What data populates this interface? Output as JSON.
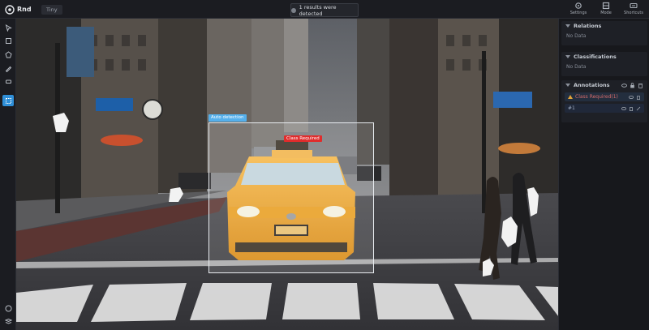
{
  "app": {
    "logo_text": "Rnd"
  },
  "tabs": {
    "file_tab": "Tiny"
  },
  "detection": {
    "status": "1 results were detected"
  },
  "top_actions": [
    {
      "label": "Settings"
    },
    {
      "label": "Mode"
    },
    {
      "label": "Shortcuts"
    }
  ],
  "tools": [
    {
      "icon": "select-tool-icon"
    },
    {
      "icon": "rectangle-tool-icon"
    },
    {
      "icon": "polygon-tool-icon"
    },
    {
      "icon": "brush-tool-icon"
    },
    {
      "icon": "eraser-tool-icon"
    },
    {
      "icon": "magic-wand-tool-icon"
    },
    {
      "icon": "auto-detect-tool-icon"
    }
  ],
  "canvas": {
    "bbox_label": "Auto detection",
    "class_label": "Class Required"
  },
  "panel": {
    "section1": {
      "title": "Relations",
      "empty_text": "No Data"
    },
    "section2": {
      "title": "Classifications",
      "empty_text": "No Data"
    },
    "section3": {
      "title": "Annotations",
      "rows": [
        {
          "label": "Class Required(1)"
        },
        {
          "label": "#1"
        }
      ]
    }
  },
  "colors": {
    "accent": "#2f8fd8",
    "bbox_tag": "#55b0ec",
    "class_tag": "#e02c2c",
    "taxi": "#f0a92a"
  }
}
